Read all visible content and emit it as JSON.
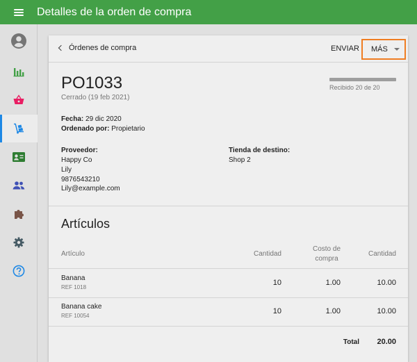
{
  "app": {
    "title": "Detalles de la orden de compra",
    "brand_color": "#43a047",
    "accent_color": "#1e88e5",
    "highlight_color": "#ef7d22"
  },
  "sidebar": {
    "items": [
      {
        "icon": "account-circle-icon",
        "color": "#757575"
      },
      {
        "icon": "bar-chart-icon",
        "color": "#43a047"
      },
      {
        "icon": "shopping-basket-icon",
        "color": "#e91e63"
      },
      {
        "icon": "dolly-cart-icon",
        "color": "#1e88e5",
        "active": true
      },
      {
        "icon": "contact-card-icon",
        "color": "#2e7d32"
      },
      {
        "icon": "people-icon",
        "color": "#3f51b5"
      },
      {
        "icon": "puzzle-icon",
        "color": "#795548"
      },
      {
        "icon": "gear-icon",
        "color": "#455a64"
      },
      {
        "icon": "help-circle-icon",
        "color": "#1e88e5"
      }
    ]
  },
  "header": {
    "back_label": "Órdenes de compra",
    "send_label": "ENVIAR",
    "more_label": "MÁS"
  },
  "order": {
    "number": "PO1033",
    "status": "Cerrado (19 feb 2021)",
    "received_progress": 1.0,
    "received_text": "Recibido 20 de 20",
    "date_label": "Fecha:",
    "date_value": "29 dic 2020",
    "ordered_by_label": "Ordenado por:",
    "ordered_by_value": "Propietario",
    "supplier_label": "Proveedor:",
    "supplier_lines": [
      "Happy Co",
      "Lily",
      "9876543210",
      "Lily@example.com"
    ],
    "store_label": "Tienda de destino:",
    "store_value": "Shop 2"
  },
  "items": {
    "title": "Artículos",
    "columns": {
      "article": "Artículo",
      "quantity": "Cantidad",
      "cost_line1": "Costo de",
      "cost_line2": "compra",
      "amount": "Cantidad"
    },
    "rows": [
      {
        "name": "Banana",
        "ref": "REF 1018",
        "quantity": "10",
        "cost": "1.00",
        "amount": "10.00"
      },
      {
        "name": "Banana cake",
        "ref": "REF 10054",
        "quantity": "10",
        "cost": "1.00",
        "amount": "10.00"
      }
    ],
    "total_label": "Total",
    "total_value": "20.00"
  }
}
